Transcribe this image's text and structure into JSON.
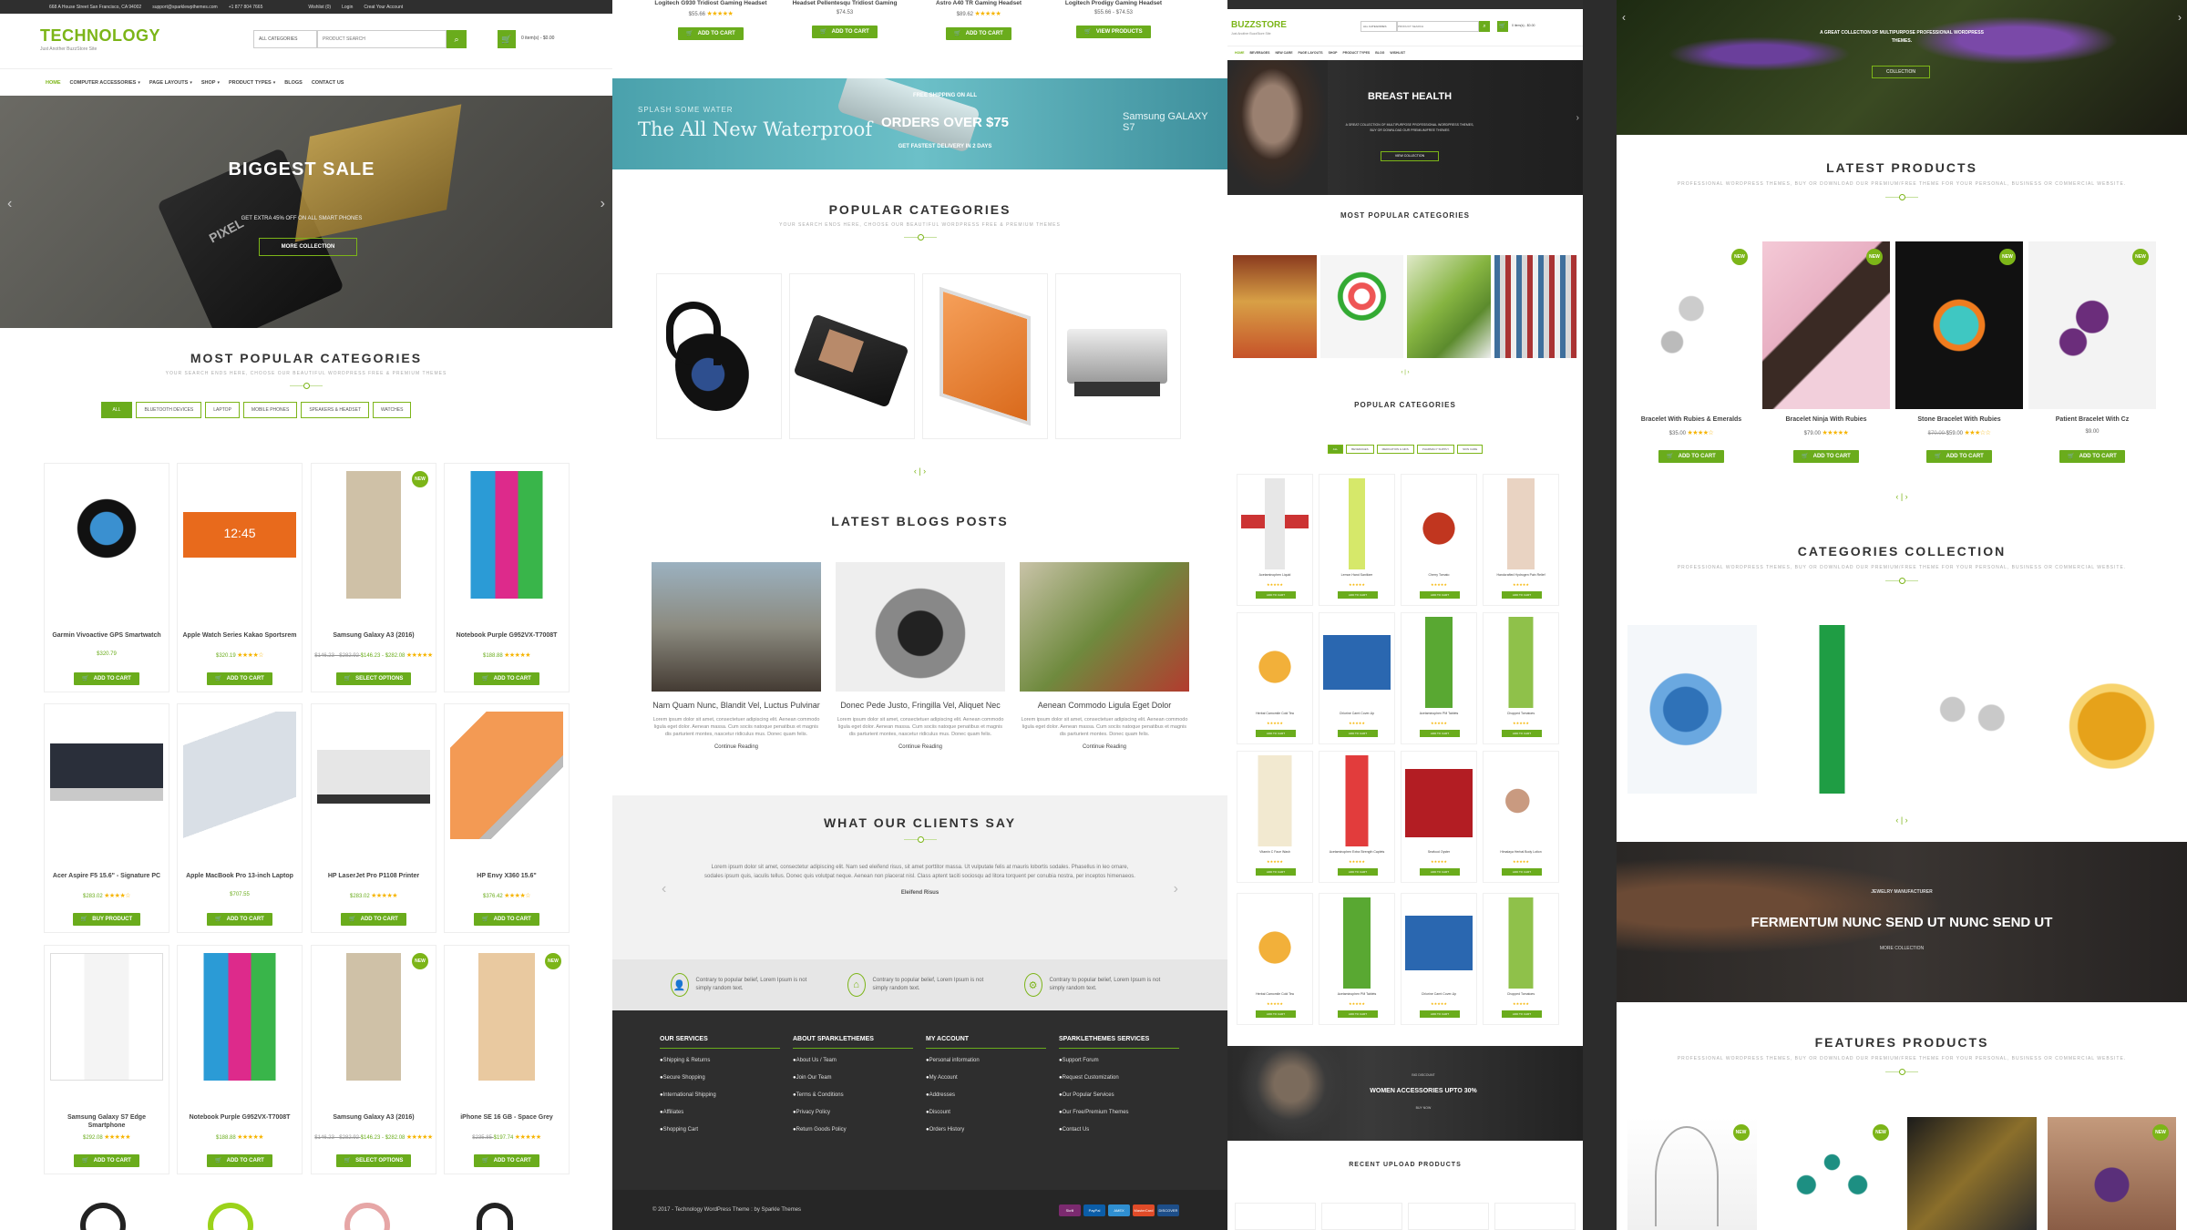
{
  "themes": {
    "technology": {
      "topbar": {
        "address": "668 A House Street San Francisco, CA 94002",
        "email": "support@sparklewpthemes.com",
        "phone": "+1 877 804 7665",
        "wishlist": "Wishlist (0)",
        "login": "Login",
        "account": "Creat Your Account"
      },
      "logo": "TECHNOLOGY",
      "tagline": "Just Another BuzzStore Site",
      "search": {
        "category": "ALL CATEGORIES",
        "placeholder": "PRODUCT SEARCH"
      },
      "cart": "0 item(s) - $0.00",
      "nav": [
        "HOME",
        "COMPUTER ACCESSORIES",
        "PAGE LAYOUTS",
        "SHOP",
        "PRODUCT TYPES",
        "BLOGS",
        "CONTACT US"
      ],
      "hero": {
        "title": "BIGGEST SALE",
        "subtitle": "GET EXTRA 45% OFF ON ALL SMART PHONES",
        "button": "MORE COLLECTION",
        "device_text": "PIXEL"
      },
      "categories": {
        "title": "MOST POPULAR CATEGORIES",
        "subtitle": "YOUR SEARCH ENDS HERE, CHOOSE OUR BEAUTIFUL WORDPRESS FREE & PREMIUM THEMES",
        "tabs": [
          "ALL",
          "BLUETOOTH DEVICES",
          "LAPTOP",
          "MOBILE PHONES",
          "SPEAKERS & HEADSET",
          "WATCHES"
        ]
      },
      "products": [
        {
          "name": "Garmin Vivoactive GPS Smartwatch",
          "price": "$320.79",
          "old": "",
          "btn": "ADD TO CART",
          "new": false,
          "stars": "",
          "icon": "watch"
        },
        {
          "name": "Apple Watch Series Kakao Sportsrem",
          "price": "$320.19",
          "old": "",
          "btn": "ADD TO CART",
          "new": false,
          "stars": "★★★★☆",
          "icon": "band",
          "band_time": "12:45"
        },
        {
          "name": "Samsung Galaxy A3 (2016)",
          "price": "$146.23 - $282.08",
          "old": "$146.23 - $282.92",
          "btn": "SELECT OPTIONS",
          "new": true,
          "stars": "★★★★★",
          "icon": "phone"
        },
        {
          "name": "Notebook Purple G952VX-T7008T",
          "price": "$188.88",
          "old": "",
          "btn": "ADD TO CART",
          "new": false,
          "stars": "★★★★★",
          "icon": "ipods"
        },
        {
          "name": "Acer Aspire F5 15.6\" - Signature PC",
          "price": "$283.02",
          "old": "",
          "btn": "BUY PRODUCT",
          "new": false,
          "stars": "★★★★☆",
          "icon": "laptop"
        },
        {
          "name": "Apple MacBook Pro 13-inch Laptop",
          "price": "$707.55",
          "old": "",
          "btn": "ADD TO CART",
          "new": false,
          "stars": "",
          "icon": "tablet"
        },
        {
          "name": "HP LaserJet Pro P1108 Printer",
          "price": "$283.02",
          "old": "",
          "btn": "ADD TO CART",
          "new": false,
          "stars": "★★★★★",
          "icon": "printer"
        },
        {
          "name": "HP Envy X360 15.6\"",
          "price": "$376.42",
          "old": "",
          "btn": "ADD TO CART",
          "new": false,
          "stars": "★★★★☆",
          "icon": "laptop2"
        },
        {
          "name": "Samsung Galaxy S7 Edge Smartphone",
          "price": "$292.08",
          "old": "",
          "btn": "ADD TO CART",
          "new": false,
          "stars": "★★★★★",
          "icon": "phonew"
        },
        {
          "name": "Notebook Purple G952VX-T7008T",
          "price": "$188.88",
          "old": "",
          "btn": "ADD TO CART",
          "new": false,
          "stars": "★★★★★",
          "icon": "ipods"
        },
        {
          "name": "Samsung Galaxy A3 (2016)",
          "price": "$146.23 - $282.08",
          "old": "$146.23 - $282.92",
          "btn": "SELECT OPTIONS",
          "new": true,
          "stars": "★★★★★",
          "icon": "phone"
        },
        {
          "name": "iPhone SE 16 GB - Space Grey",
          "price": "$197.74",
          "old": "$235.85",
          "btn": "ADD TO CART",
          "new": true,
          "stars": "★★★★★",
          "icon": "iphone"
        }
      ]
    },
    "center": {
      "top_products": [
        {
          "name": "Logitech G930 Tridiost Gaming Headset",
          "price": "$55.66",
          "btn": "ADD TO CART",
          "stars": "★★★★★"
        },
        {
          "name": "Headset Pellentesqu Tridiost Gaming",
          "price": "$74.53",
          "btn": "ADD TO CART",
          "stars": ""
        },
        {
          "name": "Astro A40 TR Gaming Headset",
          "price": "$89.62",
          "btn": "ADD TO CART",
          "stars": "★★★★★"
        },
        {
          "name": "Logitech Prodigy Gaming Headset",
          "price": "$55.66 - $74.53",
          "btn": "VIEW PRODUCTS",
          "stars": ""
        }
      ],
      "banner": {
        "small": "FREE SHIPPING ON ALL",
        "main": "ORDERS OVER $75",
        "sub": "GET FASTEST DELIVERY IN 2 DAYS",
        "left_small": "SPLASH SOME WATER",
        "left_big": "The All New Waterproof",
        "right": "Samsung GALAXY S7"
      },
      "popular": {
        "title": "POPULAR CATEGORIES",
        "subtitle": "YOUR SEARCH ENDS HERE, CHOOSE OUR BEAUTIFUL WORDPRESS FREE & PREMIUM THEMES"
      },
      "blogs": {
        "title": "LATEST BLOGS POSTS",
        "posts": [
          {
            "title": "Nam Quam Nunc, Blandit Vel, Luctus Pulvinar",
            "body": "Lorem ipsum dolor sit amet, consectetuer adipiscing elit. Aenean commodo ligula eget dolor. Aenean massa. Cum sociis natoque penatibus et magnis dis parturient montes, nascetur ridiculus mus. Donec quam felis.",
            "link": "Continue Reading"
          },
          {
            "title": "Donec Pede Justo, Fringilla Vel, Aliquet Nec",
            "body": "Lorem ipsum dolor sit amet, consectetuer adipiscing elit. Aenean commodo ligula eget dolor. Aenean massa. Cum sociis natoque penatibus et magnis dis parturient montes, nascetur ridiculus mus. Donec quam felis.",
            "link": "Continue Reading"
          },
          {
            "title": "Aenean Commodo Ligula Eget Dolor",
            "body": "Lorem ipsum dolor sit amet, consectetuer adipiscing elit. Aenean commodo ligula eget dolor. Aenean massa. Cum sociis natoque penatibus et magnis dis parturient montes. Donec quam felis.",
            "link": "Continue Reading"
          }
        ]
      },
      "clients": {
        "title": "WHAT OUR CLIENTS SAY",
        "quote": "Lorem ipsum dolor sit amet, consectetur adipiscing elit. Nam sed eleifend risus, sit amet porttitor massa. Ut vulputate felis at mauris lobortis sodales. Phasellus in leo ornare, sodales ipsum quis, iaculis tellus. Donec quis volutpat neque. Aenean non placerat nisl. Class aptent taciti sociosqu ad litora torquent per conubia nostra, per inceptos himenaeos.",
        "author": "Eleifend Risus"
      },
      "features": [
        "Contrary to popular belief, Lorem Ipsum is not simply random text.",
        "Contrary to popular belief, Lorem Ipsum is not simply random text.",
        "Contrary to popular belief, Lorem Ipsum is not simply random text."
      ],
      "footer": {
        "cols": [
          {
            "title": "OUR SERVICES",
            "items": [
              "Shipping & Returns",
              "Secure Shopping",
              "International Shipping",
              "Affiliates",
              "Shopping Cart"
            ]
          },
          {
            "title": "ABOUT SPARKLETHEMES",
            "items": [
              "About Us / Team",
              "Join Our Team",
              "Terms & Conditions",
              "Privacy Policy",
              "Return Goods Policy"
            ]
          },
          {
            "title": "MY ACCOUNT",
            "items": [
              "Personal information",
              "My Account",
              "Addresses",
              "Discount",
              "Orders History"
            ]
          },
          {
            "title": "SPARKLETHEMES SERVICES",
            "items": [
              "Support Forum",
              "Request Customization",
              "Our Popular Services",
              "Our Free/Premium Themes",
              "Contact Us"
            ]
          }
        ],
        "copyright": "© 2017 - Technology WordPress Theme : by Sparkle Themes",
        "payments": [
          "Skrill",
          "PayPal",
          "AMEX",
          "MasterCard",
          "DISCOVER"
        ]
      }
    },
    "buzzstore": {
      "logo": "BUZZSTORE",
      "tagline": "Just Another BuzzStore Site",
      "search": {
        "category": "ALL CATEGORIES",
        "placeholder": "PRODUCT SEARCH"
      },
      "cart": "0 item(s) - $0.00",
      "nav": [
        "HOME",
        "BEVERAGES",
        "NEW CARE",
        "PAGE LAYOUTS",
        "SHOP",
        "PRODUCT TYPES",
        "BLOG",
        "WISHLIST"
      ],
      "hero": {
        "title": "BREAST HEALTH",
        "subtitle": "A GREAT COLLECTION OF MULTIPURPOSE PROFESSIONAL WORDPRESS THEMES, BUY OR DOWNLOAD OUR PREMIUM/FREE THEMES",
        "button": "VIEW COLLECTION"
      },
      "most_popular": "MOST POPULAR CATEGORIES",
      "popular": "POPULAR CATEGORIES",
      "tabs": [
        "ALL",
        "BEVERAGES",
        "MEDICATION & AIDS",
        "PHARMACY SUPPLY",
        "SKIN CARE"
      ],
      "grid_names": [
        "Acetaminophen Liquid",
        "Lemon Hand Sanitizer",
        "Cherry Tomato",
        "Handcrafted Hydrogen Pain Relief",
        "Herbal Camomile Cold Tea",
        "Chlorine Carnt Cover-Up",
        "Acetaminophen PM Tablets",
        "Chopped Tomatoes",
        "Vitamin C Face Wash",
        "Acetaminophen Extra Strength Caplets",
        "Seafood Oyster",
        "Himalaya Herbal Body Lotion",
        "Herbal Camomile Cold Tea",
        "Acetaminophen PM Tablets",
        "Chlorine Carnt Cover-Up",
        "Chopped Tomatoes"
      ],
      "banner2": {
        "small": "BIG DISCOUNT",
        "title": "WOMEN ACCESSORIES UPTO 30%",
        "link": "BUY NOW"
      },
      "recent": "RECENT UPLOAD PRODUCTS",
      "btn": "ADD TO CART"
    },
    "jewelry": {
      "hero": {
        "subtitle": "A GREAT COLLECTION OF MULTIPURPOSE PROFESSIONAL WORDPRESS THEMES.",
        "button": "COLLECTION"
      },
      "latest": {
        "title": "LATEST PRODUCTS",
        "subtitle": "PROFESSIONAL WORDPRESS THEMES, BUY OR DOWNLOAD OUR PREMIUM/FREE THEME FOR YOUR PERSONAL, BUSINESS OR COMMERCIAL WEBSITE.",
        "items": [
          {
            "name": "Bracelet With Rubies & Emeralds",
            "price": "$35.00",
            "old": "",
            "stars": "★★★★☆",
            "btn": "ADD TO CART"
          },
          {
            "name": "Bracelet Ninja With Rubies",
            "price": "$79.00",
            "old": "",
            "stars": "★★★★★",
            "btn": "ADD TO CART"
          },
          {
            "name": "Stone Bracelet With Rubies",
            "price": "$59.00",
            "old": "$70.00",
            "stars": "★★★☆☆",
            "btn": "ADD TO CART"
          },
          {
            "name": "Patient Bracelet With Cz",
            "price": "$9.00",
            "old": "",
            "stars": "",
            "btn": "ADD TO CART"
          }
        ]
      },
      "collection": {
        "title": "CATEGORIES COLLECTION",
        "subtitle": "PROFESSIONAL WORDPRESS THEMES, BUY OR DOWNLOAD OUR PREMIUM/FREE THEME FOR YOUR PERSONAL, BUSINESS OR COMMERCIAL WEBSITE."
      },
      "banner": {
        "small": "JEWELRY MANUFACTURER",
        "title": "FERMENTUM NUNC SEND UT NUNC SEND UT",
        "link": "MORE COLLECTION"
      },
      "features": {
        "title": "FEATURES PRODUCTS",
        "subtitle": "PROFESSIONAL WORDPRESS THEMES, BUY OR DOWNLOAD OUR PREMIUM/FREE THEME FOR YOUR PERSONAL, BUSINESS OR COMMERCIAL WEBSITE."
      },
      "new_label": "NEW"
    }
  },
  "colors": {
    "accent": "#7cb518",
    "button": "#6aac1c",
    "dark": "#2c2c2c",
    "stars": "#f6b400"
  }
}
